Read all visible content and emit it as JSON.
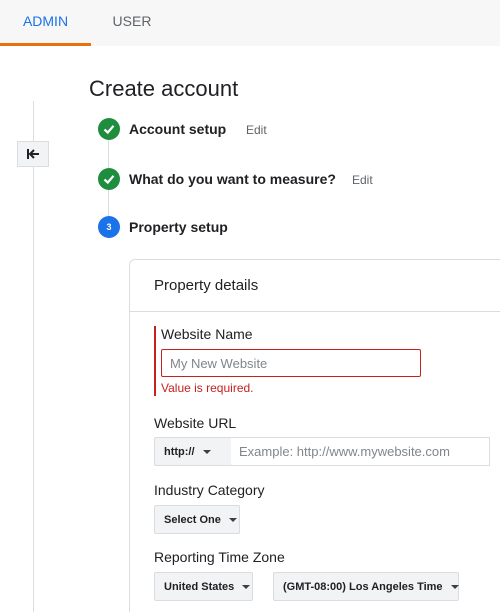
{
  "tabs": [
    {
      "label": "ADMIN",
      "active": true
    },
    {
      "label": "USER",
      "active": false
    }
  ],
  "back_icon": "arrow-left-bar-icon",
  "page_title": "Create account",
  "steps": [
    {
      "label": "Account setup",
      "status": "complete",
      "edit": "Edit",
      "icon": "check-icon"
    },
    {
      "label": "What do you want to measure?",
      "status": "complete",
      "edit": "Edit",
      "icon": "check-icon"
    },
    {
      "number": "3",
      "label": "Property setup",
      "status": "current"
    }
  ],
  "property_details": {
    "title": "Property details",
    "website_name": {
      "label": "Website Name",
      "placeholder": "My New Website",
      "value": "",
      "error": "Value is required."
    },
    "website_url": {
      "label": "Website URL",
      "protocol": "http://",
      "placeholder": "Example: http://www.mywebsite.com",
      "value": ""
    },
    "industry_category": {
      "label": "Industry Category",
      "selected": "Select One"
    },
    "reporting_time_zone": {
      "label": "Reporting Time Zone",
      "country": "United States",
      "zone": "(GMT-08:00) Los Angeles Time"
    }
  },
  "colors": {
    "accent_blue": "#1a73e8",
    "tab_underline": "#e8710a",
    "success_green": "#1e8e3e",
    "error_red": "#c5221f"
  }
}
